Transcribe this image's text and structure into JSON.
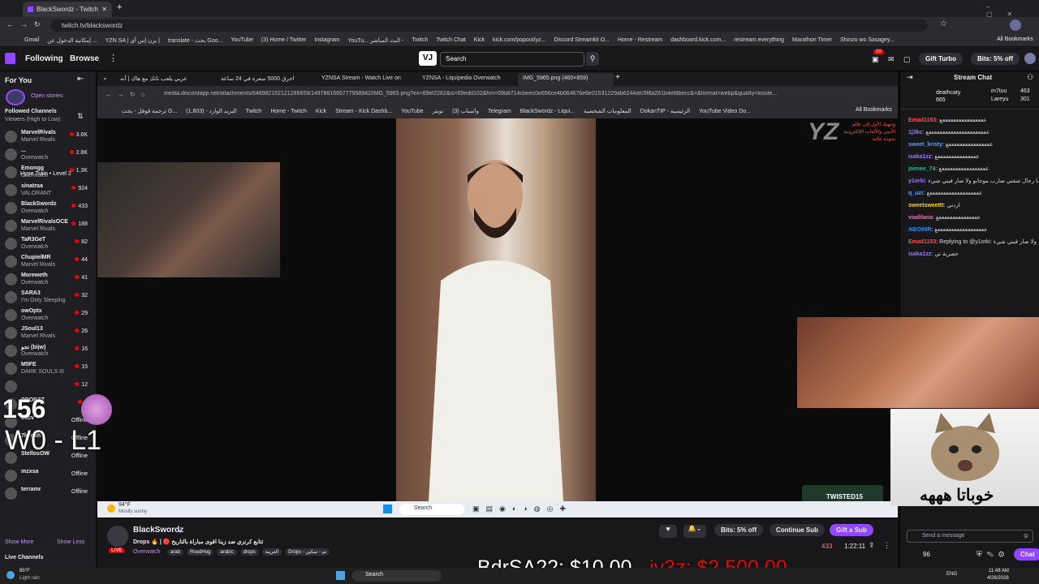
{
  "outer_browser": {
    "tab_title": "BlackSwordz - Twitch",
    "url": "twitch.tv/blackswordz",
    "bookmarks": [
      "Gmail",
      "إمكانية الدخول عن ...",
      "YZN SA | يزن إس آي |",
      "translate - بحث Goo...",
      "YouTube",
      "(3) Home / Twitter",
      "Instagram",
      "YouTu... البث المباشر -",
      "Twitch",
      "Twitch Chat",
      "Kick",
      "kick.com/popout/yz...",
      "Discord Streamkit O...",
      "Home - Restream",
      "dashboard.kick.com...",
      "restream everything",
      "Marathon Timer",
      "Shinzo wo Sasagey..."
    ],
    "all_bookmarks": "All Bookmarks"
  },
  "twitch_nav": {
    "following": "Following",
    "browse": "Browse",
    "search_placeholder": "Search",
    "notif_count": "20",
    "gift_turbo": "Gift Turbo",
    "bits_off": "Bits: 5% off"
  },
  "sidebar": {
    "for_you": "For You",
    "open_stories": "Open stories",
    "followed_channels": "Followed Channels",
    "sort": "Viewers (High to Low)",
    "channels": [
      {
        "name": "MarvelRivals",
        "game": "Marvel Rivals",
        "viewers": "3.6K",
        "live": true
      },
      {
        "name": "...",
        "game": "Overwatch",
        "viewers": "2.8K",
        "live": true
      },
      {
        "name": "Emongg",
        "game": "Overwatch",
        "viewers": "1.3K",
        "live": true
      },
      {
        "name": "sinatraa",
        "game": "VALORANT",
        "viewers": "924",
        "live": true
      },
      {
        "name": "BlackSwordz",
        "game": "Overwatch",
        "viewers": "433",
        "live": true
      },
      {
        "name": "MarvelRivalsOCE",
        "game": "Marvel Rivals",
        "viewers": "188",
        "live": true
      },
      {
        "name": "TaR3GeT",
        "game": "Overwatch",
        "viewers": "82",
        "live": true
      },
      {
        "name": "ChupielMR",
        "game": "Marvel Rivals",
        "viewers": "44",
        "live": true
      },
      {
        "name": "Moreweth",
        "game": "Overwatch",
        "viewers": "41",
        "live": true
      },
      {
        "name": "SARA3",
        "game": "I'm Only Sleeping",
        "viewers": "32",
        "live": true
      },
      {
        "name": "owOptx",
        "game": "Overwatch",
        "viewers": "29",
        "live": true
      },
      {
        "name": "JSoul13",
        "game": "Marvel Rivals",
        "viewers": "26",
        "live": true
      },
      {
        "name": "نجو (biįw)",
        "game": "Overwatch",
        "viewers": "16",
        "live": true
      },
      {
        "name": "M5FE",
        "game": "DARK SOULS III",
        "viewers": "15",
        "live": true
      },
      {
        "name": "",
        "game": "",
        "viewers": "12",
        "live": true
      },
      {
        "name": "PROBZZ",
        "game": "",
        "viewers": "8",
        "live": true
      },
      {
        "name": "b0cv",
        "game": "",
        "viewers": "Offline",
        "live": false
      },
      {
        "name": "7k7okh",
        "game": "",
        "viewers": "Offline",
        "live": false
      },
      {
        "name": "StellosOW",
        "game": "",
        "viewers": "Offline",
        "live": false
      },
      {
        "name": "mzxsa",
        "game": "",
        "viewers": "Offline",
        "live": false
      },
      {
        "name": "terramr",
        "game": "",
        "viewers": "Offline",
        "live": false
      }
    ],
    "show_more": "Show More",
    "show_less": "Show Less",
    "live_channels": "Live Channels",
    "hype_train": "Hype Train • Level 2"
  },
  "inner_browser": {
    "tabs": [
      "عربي يلعب نانك مع هاك | أنه",
      "احرق 5000 سعرة في 24 ساعة",
      "YZNSA Stream - Watch Live on",
      "YZNSA - Liquipedia Overwatch",
      "IMG_5965.png (460×859)"
    ],
    "url": "media.discordapp.net/attachments/648982152121286659/1497881665777958942/IMG_5965.png?ex=69ef2282&is=69edd102&hm=09b8714cbeec0e656ce4b064676e6e01531229ab6244afc5f8a281b4efdbecc&=&format=webp&quality=lossle...",
    "bookmarks": [
      "ترجمة قوقل - بحث G...",
      "(1,603) - البريد الوارد",
      "Twitch",
      "Home - Twitch",
      "Kick",
      "Stream - Kick Dashb...",
      "YouTube",
      "تويتر",
      "(3) واتساب",
      "Telegram",
      "BlackSwordz - Liqui...",
      "المعلومات الشخصية",
      "DokanTIP - الرئيسية",
      "YouTube Video Do..."
    ],
    "all_bookmarks": "All Bookmarks",
    "weather": "94°F",
    "weather_desc": "Mostly sunny",
    "taskbar_search": "Search",
    "twisted_label": "TWISTED15",
    "logo_text": "وحهنك الأول إلى عالم الأنمي والألعاب الإلكترونية بجودة عالية"
  },
  "stream": {
    "channel": "BlackSwordz",
    "title": "Drops 🔥 | 🔴 تتابع كرنزي ضد زينا اقوى مباراة بالتاريخ",
    "live": "LIVE",
    "game": "Overwatch",
    "tags": [
      "arab",
      "RoadHog",
      "arabic",
      "drops",
      "العربية",
      "Drops - تم - تمكين"
    ],
    "bits": "Bits: 5% off",
    "continue_sub": "Continue Sub",
    "gift_sub": "Gift a Sub",
    "viewers": "433",
    "uptime": "1:22:11"
  },
  "overlays": {
    "counter": "156",
    "score": "W0 - L1",
    "donation": "BdrSA22: $10.00",
    "donation2": "iy3z: $2,500.00",
    "cat_caption": "خوباتا هههه"
  },
  "chat": {
    "title": "Stream Chat",
    "leaders": [
      {
        "name": "deathcaty",
        "value": "665"
      },
      {
        "name": "m7tuu",
        "value": "463"
      },
      {
        "name": "Lareyu",
        "value": "301"
      }
    ],
    "messages": [
      {
        "user": "Emad1153",
        "text": "ععععععععععععععععع",
        "color": "#ff4f4f"
      },
      {
        "user": "1j3kc",
        "text": "ععععععععععععععععععععععع",
        "color": "#9b7bff"
      },
      {
        "user": "sweet_kristy",
        "text": "ععععععععععععععععع",
        "color": "#4da3ff"
      },
      {
        "user": "isaka1zz",
        "text": "عععععععععععععععع",
        "color": "#9b7bff"
      },
      {
        "user": "jaimee_74",
        "text": "عععععععععععععععععع",
        "color": "#00c98f"
      },
      {
        "user": "y1orki",
        "text": "يا رجال شفني ضارب موجابو ولا صار فيني شيء",
        "color": "#9b7bff"
      },
      {
        "user": "q_uzr",
        "text": "عععععععععععععععععععع",
        "color": "#4da3ff"
      },
      {
        "user": "sweetsweettt",
        "text": "اردني",
        "color": "#ffd700"
      },
      {
        "user": "viadilana",
        "text": "عععععععععععععععع",
        "color": "#ff69b4"
      },
      {
        "user": "ABO98R",
        "text": "ععععععععععععععععععع",
        "color": "#1e90ff"
      },
      {
        "user": "Emad1153",
        "text": "Replying to @y1orki: تراو ولا صار فيني شيء",
        "color": "#ff4f4f"
      },
      {
        "user": "isaka1zz",
        "text": "حصرية تي",
        "color": "#9b7bff"
      }
    ],
    "send_placeholder": "Send a message",
    "points": "96",
    "chat_btn": "Chat"
  },
  "taskbar": {
    "temp": "85°F",
    "weather": "Light rain",
    "search": "Search",
    "lang": "ENG",
    "time": "11:48 AM",
    "date": "4/26/2026"
  }
}
